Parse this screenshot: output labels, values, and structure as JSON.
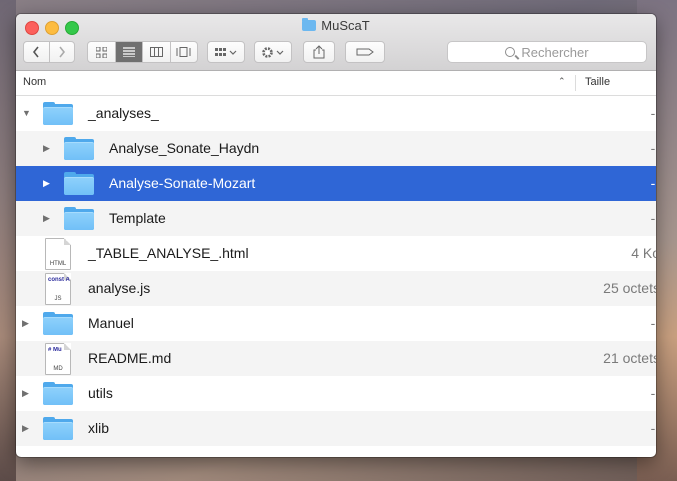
{
  "window": {
    "title": "MuScaT"
  },
  "toolbar": {
    "search_placeholder": "Rechercher"
  },
  "columns": {
    "name": "Nom",
    "size": "Taille"
  },
  "rows": [
    {
      "name": "_analyses_",
      "size": "--",
      "kind": "folder",
      "expanded": true,
      "level": 0
    },
    {
      "name": "Analyse_Sonate_Haydn",
      "size": "--",
      "kind": "folder",
      "level": 1
    },
    {
      "name": "Analyse-Sonate-Mozart",
      "size": "--",
      "kind": "folder",
      "level": 1,
      "selected": true
    },
    {
      "name": "Template",
      "size": "--",
      "kind": "folder",
      "level": 1
    },
    {
      "name": "_TABLE_ANALYSE_.html",
      "size": "4 Ko",
      "kind": "file",
      "ext": "HTML",
      "level": 0
    },
    {
      "name": "analyse.js",
      "size": "25 octets",
      "kind": "file",
      "ext": "JS",
      "preview": "const A",
      "level": 0
    },
    {
      "name": "Manuel",
      "size": "--",
      "kind": "folder",
      "level": 0
    },
    {
      "name": "README.md",
      "size": "21 octets",
      "kind": "file",
      "ext": "MD",
      "preview": "# Mu",
      "level": 0
    },
    {
      "name": "utils",
      "size": "--",
      "kind": "folder",
      "level": 0
    },
    {
      "name": "xlib",
      "size": "--",
      "kind": "folder",
      "level": 0
    }
  ],
  "colors": {
    "selection": "#2f66d6",
    "folder": "#71c0f7"
  }
}
